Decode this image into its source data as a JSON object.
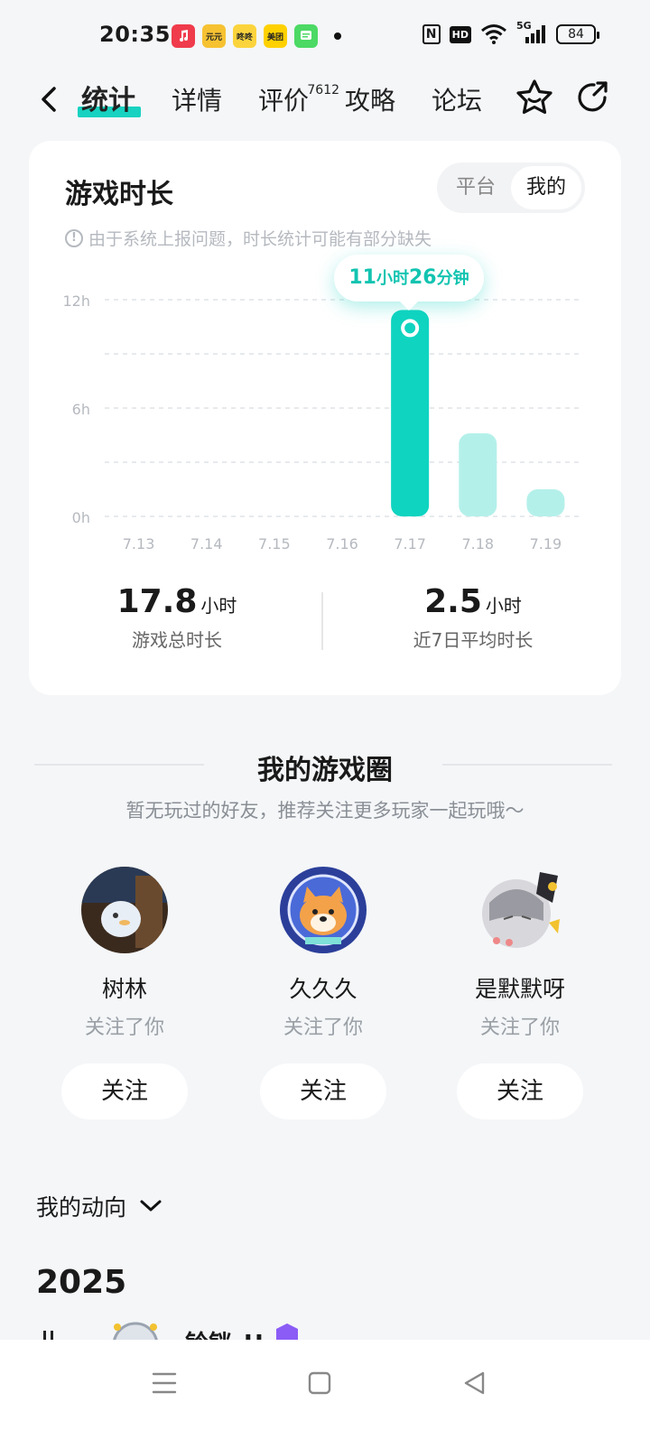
{
  "status_bar": {
    "time": "20:35",
    "app_icons": [
      {
        "name": "music-app-icon",
        "label": "",
        "color": "#ef3b4b"
      },
      {
        "name": "app-icon-yuanyuan",
        "label": "元元",
        "color": "#f6c232"
      },
      {
        "name": "app-icon-cat",
        "label": "咚咚",
        "color": "#fbd43d"
      },
      {
        "name": "meituan-icon",
        "label": "美团",
        "color": "#ffd100"
      },
      {
        "name": "message-app-icon",
        "label": "",
        "color": "#4cd964"
      }
    ],
    "network": "5G",
    "battery": "84",
    "hd": "HD",
    "nfc": "N"
  },
  "nav": {
    "tabs": [
      "统计",
      "详情",
      "评价",
      "攻略",
      "论坛"
    ],
    "active_tab": "统计",
    "review_count": "7612"
  },
  "stats_card": {
    "title": "游戏时长",
    "segments": [
      "平台",
      "我的"
    ],
    "active_segment": "我的",
    "notice": "由于系统上报问题，时长统计可能有部分缺失",
    "tooltip": {
      "hours": "11",
      "hours_unit": "小时",
      "minutes": "26",
      "minutes_unit": "分钟"
    },
    "total": {
      "value": "17.8",
      "unit": "小时",
      "label": "游戏总时长"
    },
    "average": {
      "value": "2.5",
      "unit": "小时",
      "label": "近7日平均时长"
    }
  },
  "chart_data": {
    "type": "bar",
    "categories": [
      "7.13",
      "7.14",
      "7.15",
      "7.16",
      "7.17",
      "7.18",
      "7.19"
    ],
    "values": [
      0,
      0,
      0,
      0,
      11.43,
      4.6,
      1.5
    ],
    "yticks": [
      "0h",
      "6h",
      "12h"
    ],
    "ylim": [
      0,
      12
    ],
    "highlight_index": 4,
    "colors": {
      "highlight": "#0fd4c0",
      "normal": "#b4f0ea",
      "grid": "#dfe3e7"
    }
  },
  "game_circle": {
    "title": "我的游戏圈",
    "subtitle": "暂无玩过的好友，推荐关注更多玩家一起玩哦～",
    "friends": [
      {
        "name": "树林",
        "status": "关注了你",
        "button": "关注"
      },
      {
        "name": "久久久",
        "status": "关注了你",
        "button": "关注"
      },
      {
        "name": "是默默呀",
        "status": "关注了你",
        "button": "关注"
      }
    ]
  },
  "activity": {
    "label": "我的动向",
    "year": "2025",
    "peek_text": "铃铛_H"
  },
  "bottom_nav": [
    "menu-icon",
    "home-icon",
    "back-icon"
  ]
}
